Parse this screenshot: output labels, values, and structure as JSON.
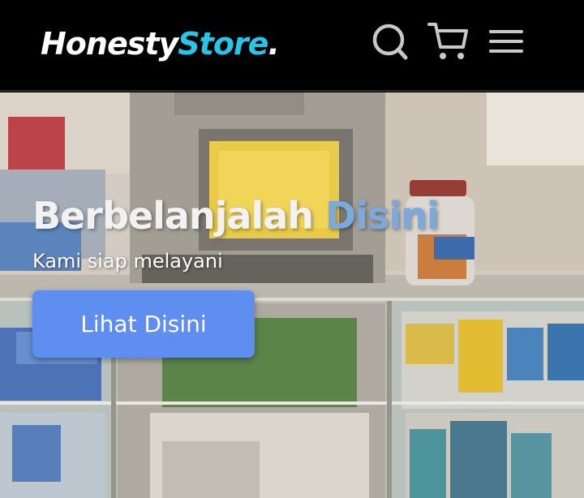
{
  "brand": {
    "part1": "Honesty",
    "part2": "Store",
    "part3": "."
  },
  "nav": {
    "icons": [
      "search-icon",
      "cart-icon",
      "hamburger-menu-icon"
    ]
  },
  "hero": {
    "title_part1": "Berbelanjalah",
    "title_part2": "Disini",
    "subtitle": "Kami siap melayani",
    "button_label": "Lihat Disini"
  },
  "colors": {
    "navbar_bg": "#000000",
    "brand_accent": "#26c6e8",
    "title_accent": "#7aa9de",
    "button_bg": "#5e8ff0",
    "icon_color": "#c8c8c8"
  }
}
